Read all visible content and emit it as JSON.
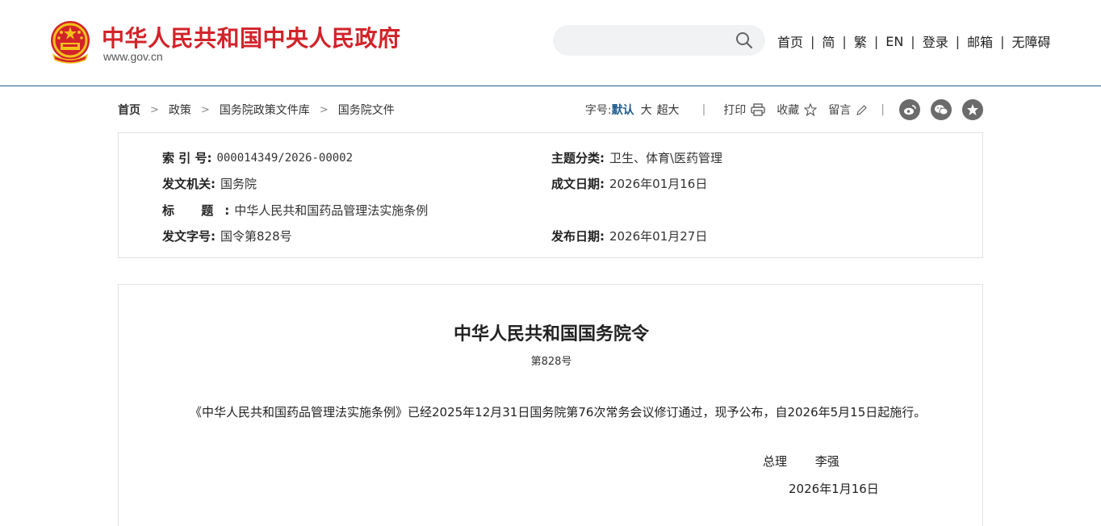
{
  "header": {
    "site_title": "中华人民共和国中央人民政府",
    "site_domain": "www.gov.cn",
    "search": {
      "value": "",
      "placeholder": ""
    },
    "nav": [
      "首页",
      "简",
      "繁",
      "EN",
      "登录",
      "邮箱",
      "无障碍"
    ]
  },
  "breadcrumb": {
    "items": [
      "首页",
      "政策",
      "国务院政策文件库",
      "国务院文件"
    ]
  },
  "tools": {
    "font_size_label": "字号:",
    "font_default": "默认",
    "font_large": "大",
    "font_xlarge": "超大",
    "print": "打印",
    "favorite": "收藏",
    "comment": "留言"
  },
  "info": {
    "index_label": "索 引 号:",
    "index_value": "000014349/2026-00002",
    "category_label": "主题分类:",
    "category_value": "卫生、体育\\医药管理",
    "issuer_label": "发文机关:",
    "issuer_value": "国务院",
    "written_label": "成文日期:",
    "written_value": "2026年01月16日",
    "title_label": "标 题:",
    "title_value": "中华人民共和国药品管理法实施条例",
    "docno_label": "发文字号:",
    "docno_value": "国令第828号",
    "published_label": "发布日期:",
    "published_value": "2026年01月27日"
  },
  "document": {
    "title": "中华人民共和国国务院令",
    "number": "第828号",
    "body": "《中华人民共和国药品管理法实施条例》已经2025年12月31日国务院第76次常务会议修订通过，现予公布，自2026年5月15日起施行。",
    "signer_title": "总理",
    "signer_name": "李强",
    "sign_date": "2026年1月16日"
  },
  "colors": {
    "brand_red": "#d2232a",
    "accent_blue": "#1f5a8c",
    "share_gray": "#6b6b6b"
  }
}
